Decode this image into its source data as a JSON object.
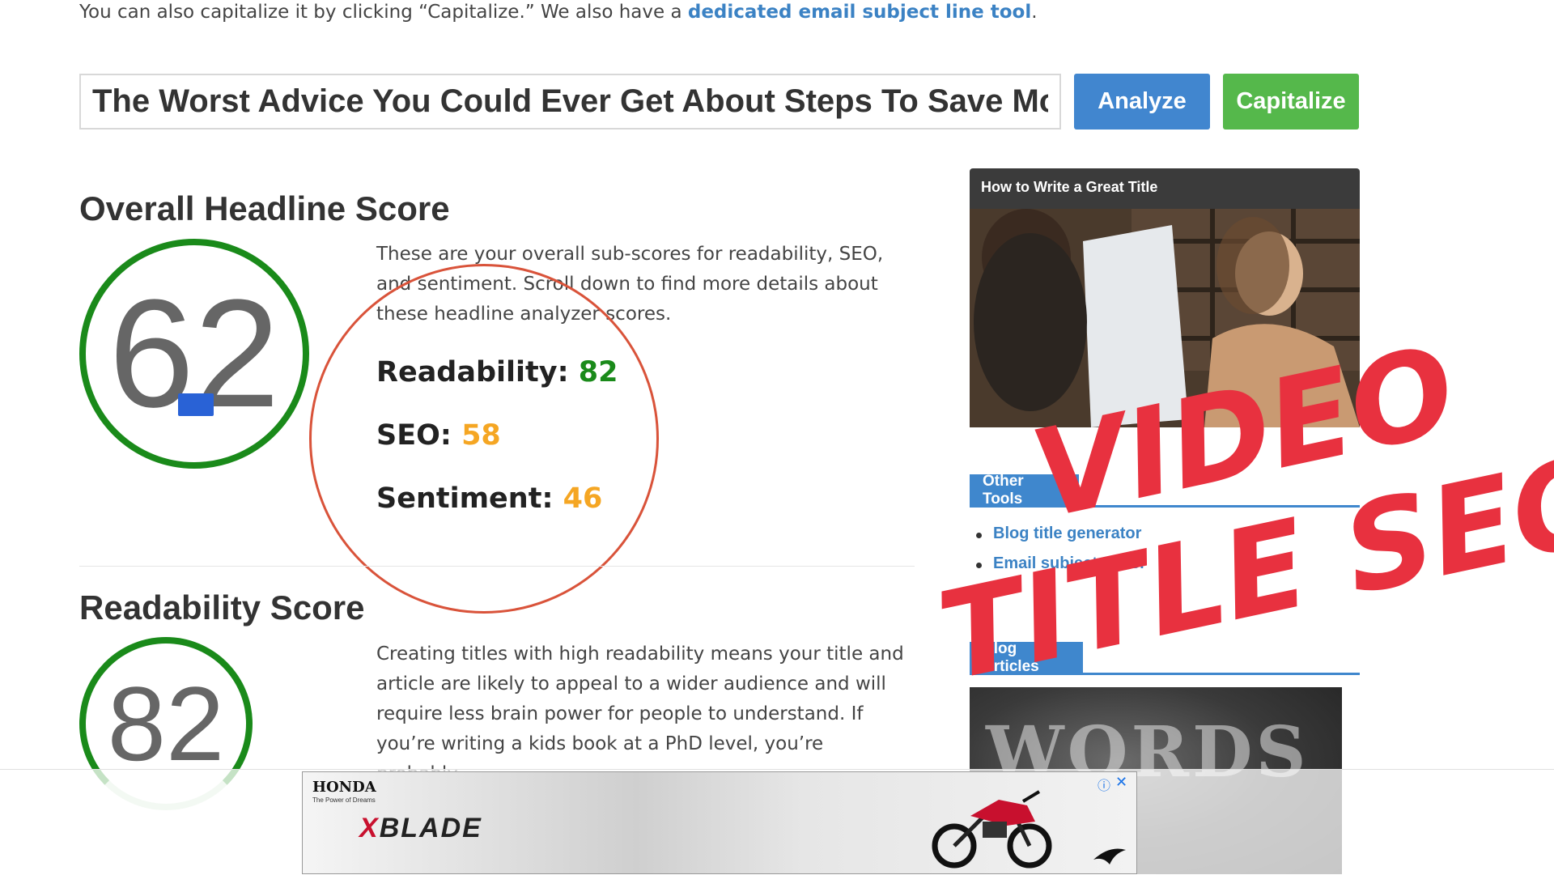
{
  "intro": {
    "text": "You can also capitalize it by clicking “Capitalize.” We also have a ",
    "link": "dedicated email subject line tool",
    "end": "."
  },
  "headline": {
    "value": "The Worst Advice You Could Ever Get About Steps To Save Mo"
  },
  "buttons": {
    "analyze": "Analyze",
    "capitalize": "Capitalize"
  },
  "overall": {
    "title": "Overall Headline Score",
    "score": "62",
    "description": "These are your overall sub-scores for readability, SEO, and sentiment. Scroll down to find more details about these headline analyzer scores.",
    "subscores": [
      {
        "label": "Readability:",
        "value": "82",
        "color": "#1a8a1a"
      },
      {
        "label": "SEO:",
        "value": "58",
        "color": "#f5a623"
      },
      {
        "label": "Sentiment:",
        "value": "46",
        "color": "#f5a623"
      }
    ]
  },
  "readability": {
    "title": "Readability Score",
    "score": "82",
    "description": "Creating titles with high readability means your title and article are likely to appeal to a wider audience and will require less brain power for people to understand. If you’re writing a kids book at a PhD level, you’re probably"
  },
  "sidebar": {
    "video_title": "How to Write a Great Title",
    "other_tools_label": "Other Tools",
    "tools": [
      "Blog title generator",
      "Email subject tester"
    ],
    "blog_articles_label": "Blog Articles",
    "blog_thumb_text": "WORDS"
  },
  "overlay": {
    "line1": "VIDEO",
    "line2": "TITLE SEO",
    "color": "#e8313f"
  },
  "ad": {
    "brand": "HONDA",
    "tagline": "The Power of Dreams",
    "product_x": "X",
    "product_rest": "BLADE",
    "info_icon": "info-icon",
    "close_icon": "close-icon"
  },
  "colors": {
    "accent_blue": "#4186cf",
    "accent_green": "#55b84b",
    "score_green": "#1a8a1a",
    "score_orange": "#f5a623"
  }
}
